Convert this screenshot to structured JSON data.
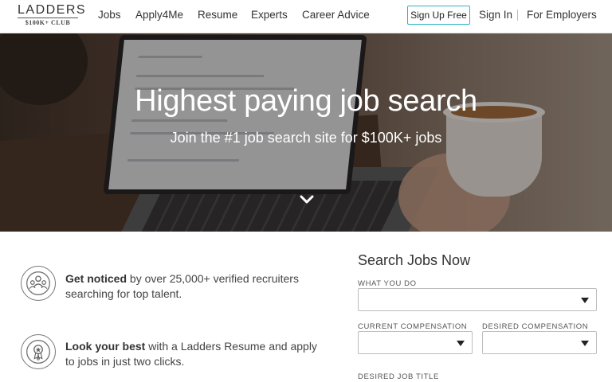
{
  "logo": {
    "main": "LADDERS",
    "sub": "$100K+ CLUB"
  },
  "nav": {
    "jobs": "Jobs",
    "apply4me": "Apply4Me",
    "resume": "Resume",
    "experts": "Experts",
    "career_advice": "Career Advice",
    "signup": "Sign Up Free",
    "signin": "Sign In",
    "employers": "For Employers"
  },
  "hero": {
    "title": "Highest paying job search",
    "subtitle": "Join the #1 job search site for $100K+ jobs"
  },
  "features": [
    {
      "bold": "Get noticed",
      "rest": " by over 25,000+ verified recruiters searching for top talent.",
      "icon": "recruiters-icon"
    },
    {
      "bold": "Look your best",
      "rest": " with a Ladders Resume and apply to jobs in just two clicks.",
      "icon": "award-icon"
    }
  ],
  "search": {
    "title": "Search Jobs Now",
    "what_you_do_label": "WHAT YOU DO",
    "current_comp_label": "CURRENT COMPENSATION",
    "desired_comp_label": "DESIRED COMPENSATION",
    "desired_title_label": "DESIRED JOB TITLE",
    "what_you_do_value": "",
    "current_comp_value": "",
    "desired_comp_value": ""
  },
  "colors": {
    "accent": "#2ab3c5",
    "text": "#333333"
  }
}
